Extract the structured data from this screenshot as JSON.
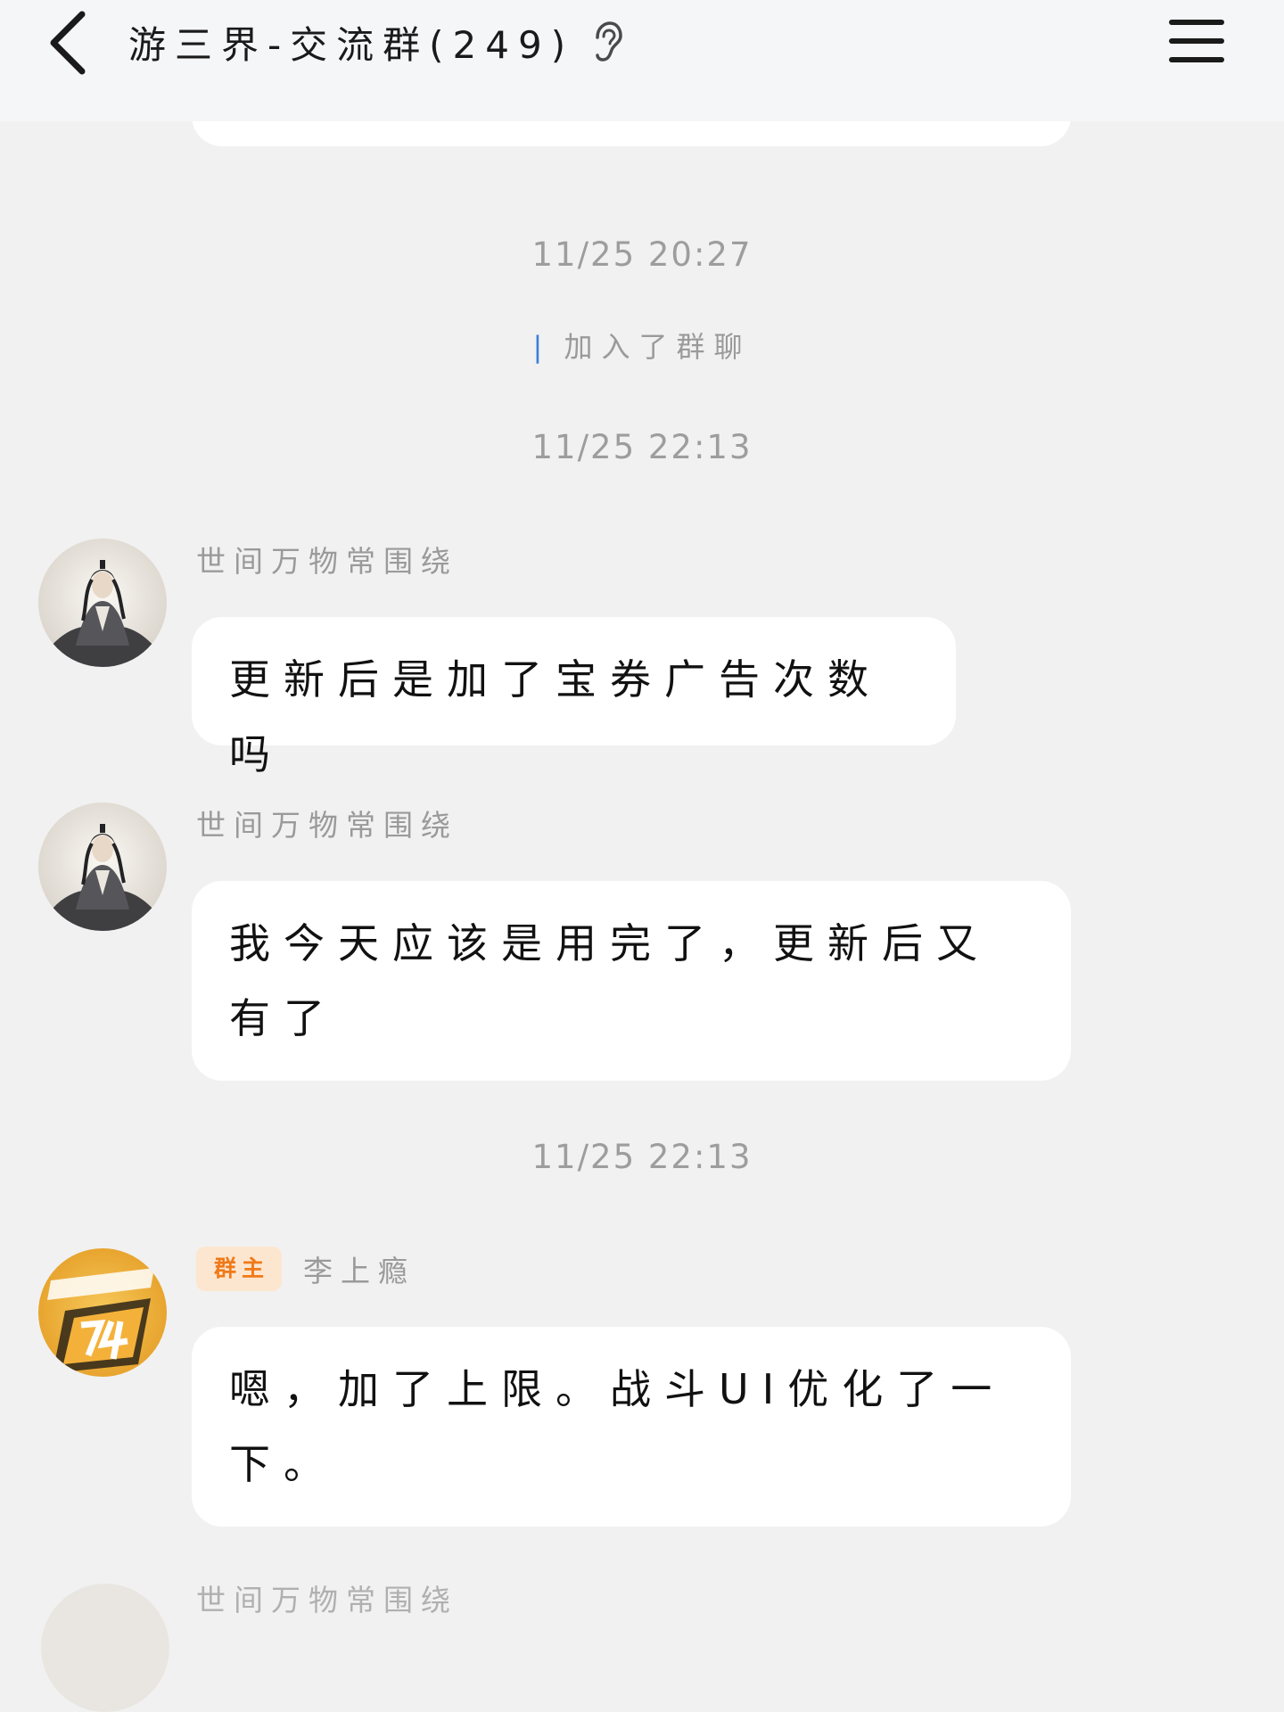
{
  "header": {
    "back_icon": "chevron-left-icon",
    "title": "游三界-交流群(249)",
    "ear_icon": "ear-icon",
    "menu_icon": "hamburger-menu-icon"
  },
  "messages": [
    {
      "type": "timestamp",
      "text": "11/25 20:27"
    },
    {
      "type": "system",
      "user": "|",
      "text": "加入了群聊"
    },
    {
      "type": "timestamp",
      "text": "11/25 22:13"
    },
    {
      "type": "message",
      "sender": "世间万物常围绕",
      "text": "更新后是加了宝券广告次数吗"
    },
    {
      "type": "message",
      "sender": "世间万物常围绕",
      "text": "我今天应该是用完了，更新后又有了"
    },
    {
      "type": "timestamp",
      "text": "11/25 22:13"
    },
    {
      "type": "message",
      "badge": "群主",
      "sender": "李上瘾",
      "text": "嗯，加了上限。战斗UI优化了一下。"
    },
    {
      "type": "message",
      "sender": "世间万物常围绕",
      "text": ""
    }
  ],
  "colors": {
    "background": "#f1f1f1",
    "header": "#f5f6f8",
    "bubble": "#ffffff",
    "timestamp": "#9d9d9d",
    "link": "#3d7fd9",
    "badge_bg": "#fde6cf",
    "badge_text": "#ef7a1a"
  }
}
